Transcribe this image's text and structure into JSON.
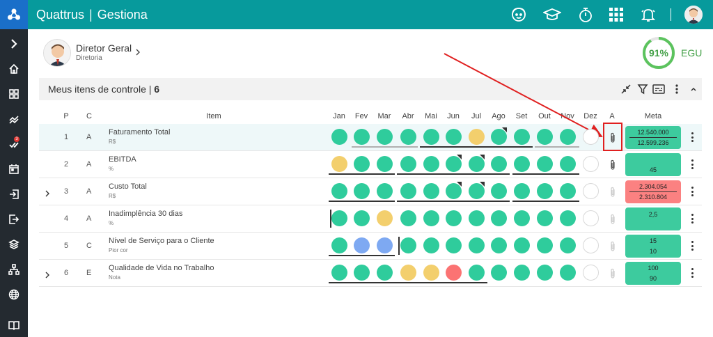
{
  "app": {
    "brand": "Quattrus",
    "product": "Gestiona",
    "separator": "|"
  },
  "topbar": {
    "icons": [
      "support-icon",
      "graduation-cap-icon",
      "stopwatch-icon",
      "apps-grid-icon",
      "bell-icon"
    ],
    "user_avatar": "user-avatar"
  },
  "sidebar": {
    "items": [
      "chevron-right-icon",
      "home-icon",
      "dashboard-icon",
      "trend-chart-icon",
      "checklist-icon",
      "calendar-icon",
      "login-icon",
      "logout-icon",
      "layers-icon",
      "hierarchy-icon",
      "globe-icon",
      "book-icon"
    ],
    "badge_count": "3"
  },
  "profile": {
    "name": "Diretor Geral",
    "subtitle": "Diretoria"
  },
  "kpi": {
    "value": "91%",
    "label": "EGU",
    "percent": 0.91,
    "color": "#5cc35e"
  },
  "panel": {
    "title": "Meus itens de controle",
    "count": "6",
    "separator": "|"
  },
  "columns": {
    "p": "P",
    "c": "C",
    "item": "Item",
    "months": [
      "Jan",
      "Fev",
      "Mar",
      "Abr",
      "Mai",
      "Jun",
      "Jul",
      "Ago",
      "Set",
      "Out",
      "Nov",
      "Dez"
    ],
    "a": "A",
    "meta": "Meta"
  },
  "colors": {
    "green": "#2fcc9c",
    "yellow": "#f3cf6d",
    "blue": "#7ea9f2",
    "red": "#fb7373",
    "teal_header": "#079a9c",
    "sidebar": "#242a30",
    "annotation": "#e02020"
  },
  "rows": [
    {
      "p": "1",
      "c": "A",
      "name": "Faturamento Total",
      "unit": "R$",
      "statuses": [
        "green",
        "green",
        "green",
        "green",
        "green",
        "green",
        "yellow",
        "green",
        "green",
        "green",
        "green",
        "empty"
      ],
      "meta": {
        "style": "green",
        "lines": [
          "12.540.000",
          "12.599.236"
        ]
      }
    },
    {
      "p": "2",
      "c": "A",
      "name": "EBITDA",
      "unit": "%",
      "statuses": [
        "yellow",
        "green",
        "green",
        "green",
        "green",
        "green",
        "green",
        "green",
        "green",
        "green",
        "green",
        "empty"
      ],
      "meta": {
        "style": "green",
        "lines": [
          "",
          "45"
        ]
      }
    },
    {
      "p": "3",
      "c": "A",
      "name": "Custo Total",
      "unit": "R$",
      "statuses": [
        "green",
        "green",
        "green",
        "green",
        "green",
        "green",
        "green",
        "green",
        "green",
        "green",
        "green",
        "empty"
      ],
      "meta": {
        "style": "red",
        "lines": [
          "2.304.054",
          "2.310.804"
        ]
      }
    },
    {
      "p": "4",
      "c": "A",
      "name": "Inadimplência 30 dias",
      "unit": "%",
      "statuses": [
        "green",
        "green",
        "yellow",
        "green",
        "green",
        "green",
        "green",
        "green",
        "green",
        "green",
        "green",
        "empty"
      ],
      "meta": {
        "style": "green",
        "lines": [
          "2,5",
          ""
        ]
      }
    },
    {
      "p": "5",
      "c": "C",
      "name": "Nível de Serviço para o Cliente",
      "unit": "Pior cor",
      "statuses": [
        "green",
        "blue",
        "blue",
        "green",
        "green",
        "green",
        "green",
        "green",
        "green",
        "green",
        "green",
        "empty"
      ],
      "meta": {
        "style": "green",
        "lines": [
          "15",
          "10"
        ]
      }
    },
    {
      "p": "6",
      "c": "E",
      "name": "Qualidade de Vida no Trabalho",
      "unit": "Nota",
      "statuses": [
        "green",
        "green",
        "green",
        "yellow",
        "yellow",
        "red",
        "green",
        "green",
        "green",
        "green",
        "green",
        "empty"
      ],
      "meta": {
        "style": "green",
        "lines": [
          "100",
          "90"
        ]
      }
    }
  ]
}
